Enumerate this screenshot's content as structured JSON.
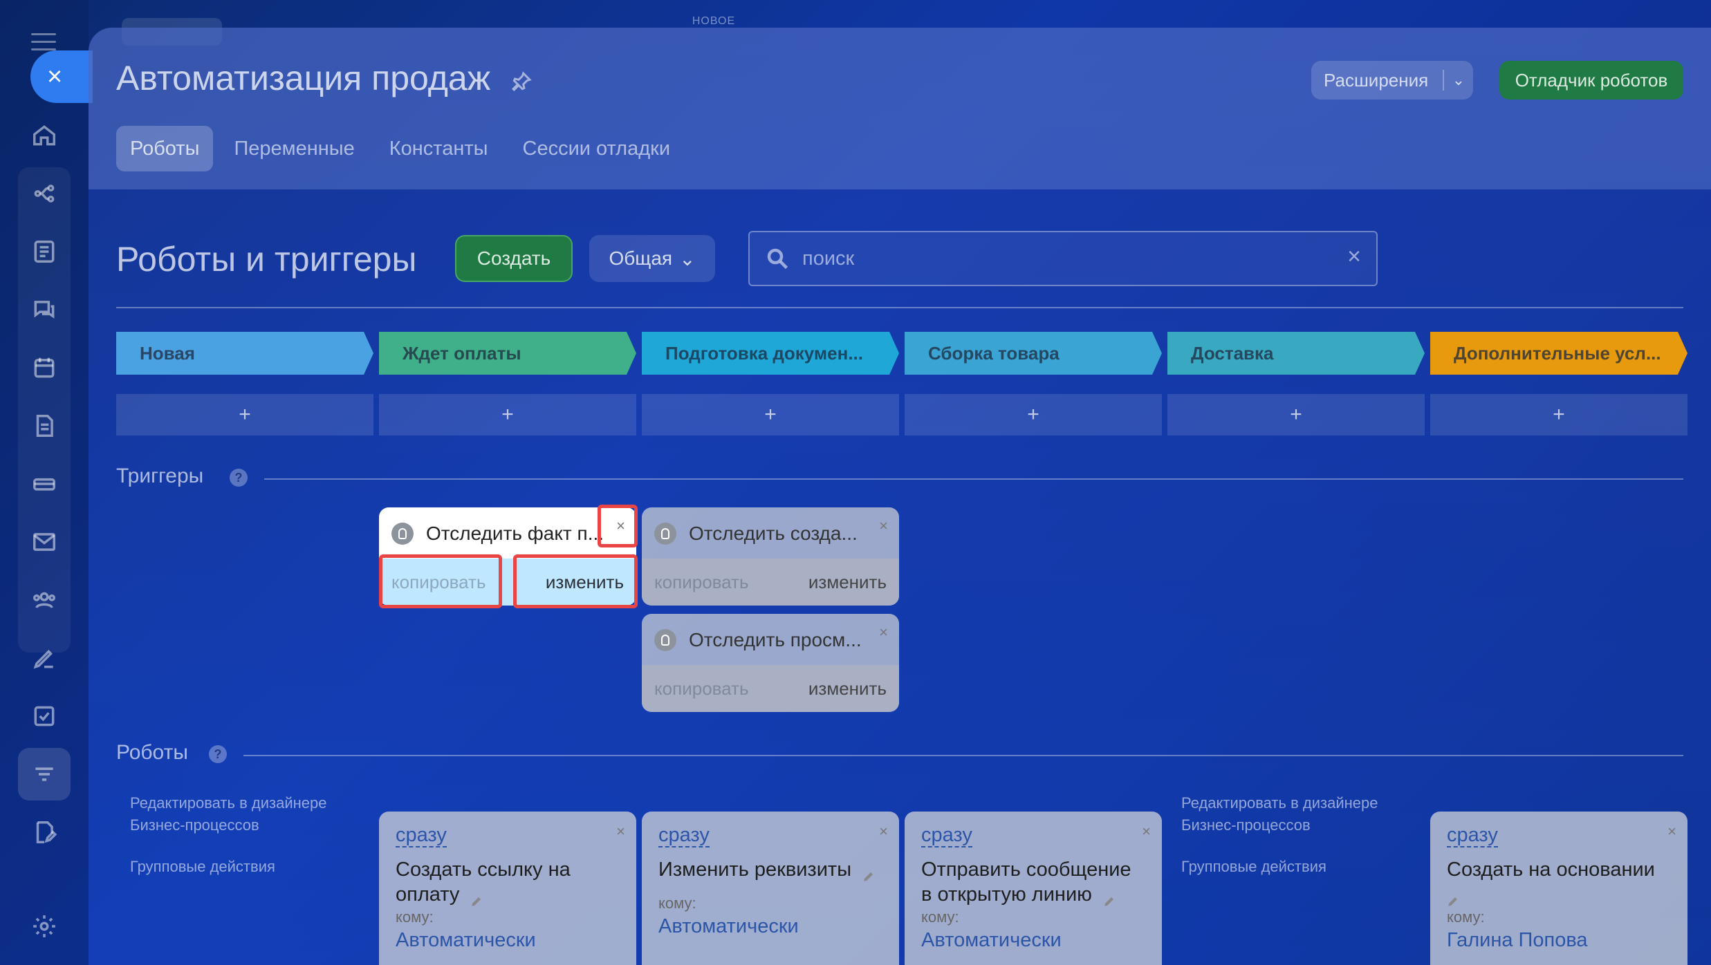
{
  "top_label": "НОВОЕ",
  "sidebar": {
    "close_icon": "close-icon",
    "items": [
      {
        "icon": "home-icon"
      },
      {
        "icon": "flow-icon"
      },
      {
        "icon": "tasks-icon"
      },
      {
        "icon": "chat-icon"
      },
      {
        "icon": "calendar-icon"
      },
      {
        "icon": "document-icon"
      },
      {
        "icon": "drive-icon"
      },
      {
        "icon": "mail-icon"
      },
      {
        "icon": "users-icon"
      },
      {
        "icon": "sign-icon"
      },
      {
        "icon": "checkbox-icon"
      },
      {
        "icon": "funnel-icon"
      },
      {
        "icon": "doc-edit-icon"
      },
      {
        "icon": "settings-icon"
      }
    ]
  },
  "header": {
    "title": "Автоматизация продаж",
    "extensions_label": "Расширения",
    "debugger_label": "Отладчик роботов",
    "tabs": [
      {
        "label": "Роботы",
        "active": true
      },
      {
        "label": "Переменные",
        "active": false
      },
      {
        "label": "Константы",
        "active": false
      },
      {
        "label": "Сессии отладки",
        "active": false
      }
    ]
  },
  "toolbar": {
    "section_title": "Роботы и триггеры",
    "create_label": "Создать",
    "general_label": "Общая",
    "search_placeholder": "поиск"
  },
  "stages": [
    {
      "label": "Новая",
      "color": "#4aa2e3"
    },
    {
      "label": "Ждет оплаты",
      "color": "#3fb08a"
    },
    {
      "label": "Подготовка докумен...",
      "color": "#1fa7d8"
    },
    {
      "label": "Сборка товара",
      "color": "#3aa5d4"
    },
    {
      "label": "Доставка",
      "color": "#39a9c2"
    },
    {
      "label": "Дополнительные усл...",
      "color": "#e89a0e"
    }
  ],
  "add_symbol": "+",
  "triggers_section": {
    "title": "Триггеры",
    "help": "?",
    "cards": [
      {
        "title": "Отследить факт п...",
        "copy": "копировать",
        "edit": "изменить",
        "close": "×"
      },
      {
        "title": "Отследить созда...",
        "copy": "копировать",
        "edit": "изменить",
        "close": "×"
      },
      {
        "title": "Отследить просм...",
        "copy": "копировать",
        "edit": "изменить",
        "close": "×"
      }
    ]
  },
  "robots_section": {
    "title": "Роботы",
    "help": "?",
    "side_links": {
      "designer_line1": "Редактировать в дизайнере",
      "designer_line2": "Бизнес-процессов",
      "group_actions": "Групповые действия"
    },
    "cards": [
      {
        "when": "сразу",
        "title": "Создать ссылку на оплату",
        "to_label": "кому:",
        "to": "Автоматически",
        "close": "×"
      },
      {
        "when": "сразу",
        "title": "Изменить реквизиты",
        "to_label": "кому:",
        "to": "Автоматически",
        "close": "×"
      },
      {
        "when": "сразу",
        "title": "Отправить сообщение в открытую линию",
        "to_label": "кому:",
        "to": "Автоматически",
        "close": "×"
      },
      {
        "when": "сразу",
        "title": "Создать на основании",
        "to_label": "кому:",
        "to": "Галина Попова",
        "close": "×"
      }
    ]
  },
  "highlight_color": "#e94545"
}
